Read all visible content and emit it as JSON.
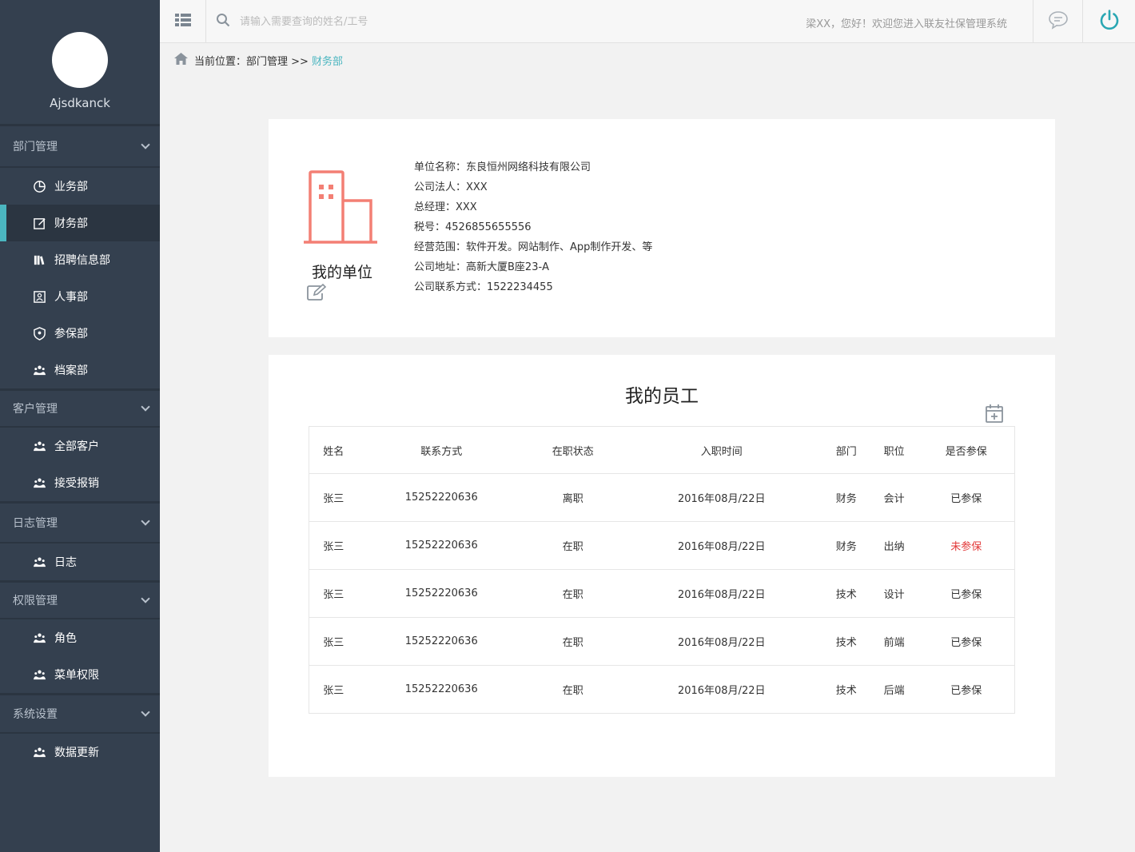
{
  "user": {
    "name": "Ajsdkanck"
  },
  "sidebar": {
    "groups": [
      {
        "title": "部门管理",
        "items": [
          {
            "label": "业务部",
            "icon": "pie-chart-icon"
          },
          {
            "label": "财务部",
            "icon": "edit-icon",
            "active": true
          },
          {
            "label": "招聘信息部",
            "icon": "books-icon"
          },
          {
            "label": "人事部",
            "icon": "id-card-icon"
          },
          {
            "label": "参保部",
            "icon": "shield-icon"
          },
          {
            "label": "档案部",
            "icon": "users-icon"
          }
        ]
      },
      {
        "title": "客户管理",
        "items": [
          {
            "label": "全部客户",
            "icon": "users-icon"
          },
          {
            "label": "接受报销",
            "icon": "users-icon"
          }
        ]
      },
      {
        "title": "日志管理",
        "items": [
          {
            "label": "日志",
            "icon": "users-icon"
          }
        ]
      },
      {
        "title": "权限管理",
        "items": [
          {
            "label": "角色",
            "icon": "users-icon"
          },
          {
            "label": "菜单权限",
            "icon": "users-icon"
          }
        ]
      },
      {
        "title": "系统设置",
        "items": [
          {
            "label": "数据更新",
            "icon": "users-icon"
          }
        ]
      }
    ]
  },
  "topbar": {
    "search_placeholder": "请输入需要查询的姓名/工号",
    "welcome": "梁XX，您好！欢迎您进入联友社保管理系统"
  },
  "breadcrumb": {
    "prefix": "当前位置：",
    "parent": "部门管理 >>",
    "current": "财务部"
  },
  "company": {
    "title": "我的单位",
    "info": [
      "单位名称：东良恒州网络科技有限公司",
      "公司法人：XXX",
      "总经理：XXX",
      "税号：4526855655556",
      "经营范围：软件开发。网站制作、App制作开发、等",
      "公司地址：高新大厦B座23-A",
      "公司联系方式：1522234455"
    ]
  },
  "employees": {
    "title": "我的员工",
    "headers": [
      "姓名",
      "联系方式",
      "在职状态",
      "入职时间",
      "部门",
      "职位",
      "是否参保"
    ],
    "rows": [
      [
        "张三",
        "15252220636",
        "离职",
        "2016年08月/22日",
        "财务",
        "会计",
        "已参保"
      ],
      [
        "张三",
        "15252220636",
        "在职",
        "2016年08月/22日",
        "财务",
        "出纳",
        "未参保"
      ],
      [
        "张三",
        "15252220636",
        "在职",
        "2016年08月/22日",
        "技术",
        "设计",
        "已参保"
      ],
      [
        "张三",
        "15252220636",
        "在职",
        "2016年08月/22日",
        "技术",
        "前端",
        "已参保"
      ],
      [
        "张三",
        "15252220636",
        "在职",
        "2016年08月/22日",
        "技术",
        "后端",
        "已参保"
      ]
    ]
  },
  "colors": {
    "accent": "#4bb6c0",
    "sidebar": "#34404f",
    "logo": "#f37f74",
    "warning": "#e23a3a"
  }
}
